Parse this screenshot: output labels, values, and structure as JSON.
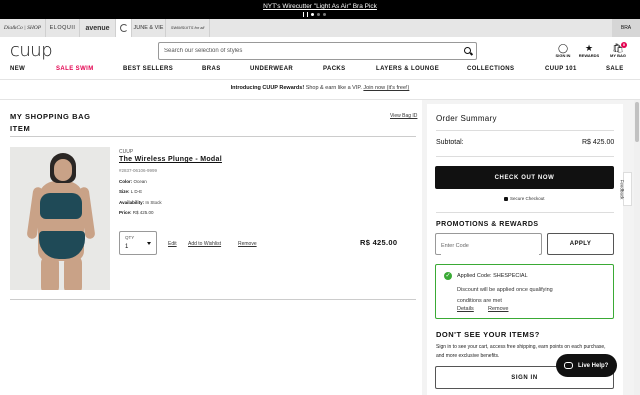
{
  "announcement": {
    "text": "NYT's Wirecutter \"Light As Air\" Bra Pick"
  },
  "brands": {
    "items": [
      "Dia&Co | SHOP",
      "ELOQUII",
      "avenue",
      "",
      "JUNE & VIE",
      "SWIMSUITS for all"
    ],
    "country": "BRA"
  },
  "header": {
    "logo": "cuup",
    "search_placeholder": "Search our selection of styles",
    "signin_label": "SIGN IN",
    "rewards_label": "REWARDS",
    "bag_label": "MY BAG",
    "bag_count": "0"
  },
  "nav": {
    "items": [
      "NEW",
      "SALE SWIM",
      "BEST SELLERS",
      "BRAS",
      "UNDERWEAR",
      "PACKS",
      "LAYERS & LOUNGE",
      "COLLECTIONS",
      "CUUP 101",
      "SALE"
    ]
  },
  "promo": {
    "title": "Introducing CUUP Rewards!",
    "text": "Shop & earn like a VIP.",
    "link": "Join now (it's free!)"
  },
  "bag": {
    "title_line1": "MY SHOPPING BAG",
    "title_line2": "ITEM",
    "view_bag_id": "View Bag ID",
    "item": {
      "brand": "CUUP",
      "name": "The Wireless Plunge - Modal",
      "sku": "#2837-06106-9999",
      "color_label": "Color:",
      "color": "Ocean",
      "size_label": "Size:",
      "size": "L D-E",
      "availability_label": "Availability:",
      "availability": "In Stock",
      "price_label": "Price:",
      "price": "R$ 425.00",
      "qty_label": "QTY",
      "qty": "1",
      "edit": "Edit",
      "add_to_wishlist": "Add to Wishlist",
      "remove": "Remove",
      "line_total": "R$ 425.00"
    }
  },
  "summary": {
    "title": "Order Summary",
    "subtotal_label": "Subtotal:",
    "subtotal": "R$ 425.00",
    "checkout": "CHECK OUT NOW",
    "secure": "Secure Checkout",
    "promo_title": "PROMOTIONS & REWARDS",
    "code_placeholder": "Enter Code",
    "apply": "APPLY",
    "applied_code": "Applied Code: SHESPECIAL",
    "applied_msg": "Discount will be applied once qualifying conditions are met",
    "details": "Details",
    "remove": "Remove",
    "dont_see_title": "DON'T SEE YOUR ITEMS?",
    "dont_see_msg": "Sign in to see your cart, access free shipping, earn points on each purchase, and more exclusive benefits.",
    "signin": "SIGN IN"
  },
  "widgets": {
    "live_help": "Live Help?",
    "feedback": "Feedback"
  },
  "colors": {
    "accent_pink": "#e3004f",
    "success_green": "#3aaa35",
    "black": "#111111"
  },
  "icons": [
    "search-icon",
    "user-icon",
    "star-icon",
    "bag-icon",
    "lock-icon",
    "check-icon",
    "chat-icon",
    "caret-down-icon"
  ]
}
